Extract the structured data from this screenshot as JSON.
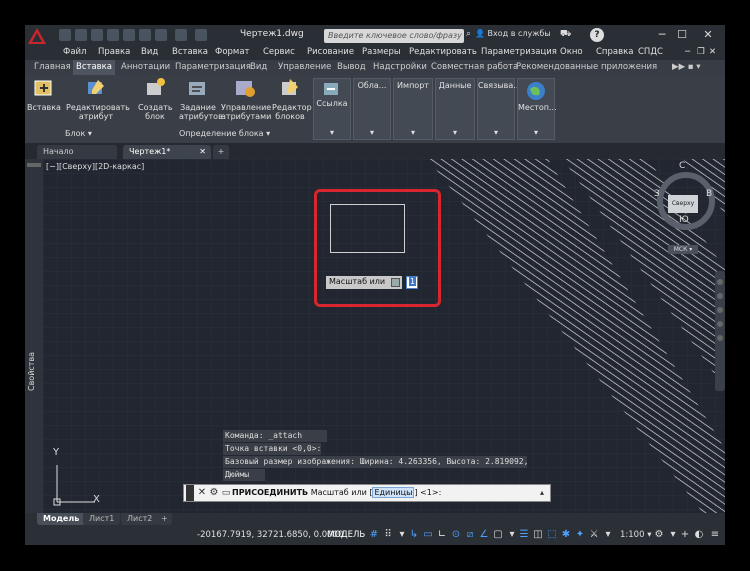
{
  "titlebar": {
    "doc_title": "Чертеж1.dwg",
    "search_placeholder": "Введите ключевое слово/фразу",
    "signin": "Вход в службы",
    "help": "?"
  },
  "menu": [
    "Файл",
    "Правка",
    "Вид",
    "Вставка",
    "Формат",
    "Сервис",
    "Рисование",
    "Размеры",
    "Редактировать",
    "Параметризация",
    "Окно",
    "Справка",
    "СПДС"
  ],
  "ribbon_tabs": [
    "Главная",
    "Вставка",
    "Аннотации",
    "Параметризация",
    "Вид",
    "Управление",
    "Вывод",
    "Надстройки",
    "Совместная работа",
    "Рекомендованные приложения"
  ],
  "ribbon_tabs_more": "▶▶ ▪ ▾",
  "ribbon": {
    "insert": "Вставка",
    "edit_attr": "Редактировать атрибут",
    "create_block": "Создать блок",
    "define_attr": "Задание атрибутов",
    "manage_attr": "Управление атрибутами",
    "block_editor": "Редактор блоков",
    "block_group": "Блок",
    "block_def_group": "Определение блока",
    "reference": "Ссылка",
    "cloud": "Обла...",
    "import": "Импорт",
    "data": "Данные",
    "link": "Связыва...",
    "location": "Местоп..."
  },
  "file_tabs": {
    "start": "Начало",
    "drawing": "Чертеж1*",
    "add": "+"
  },
  "viewport_label": "[−][Сверху][2D-каркас]",
  "side_panel_label": "Свойства",
  "tooltip": {
    "prompt": "Масштаб или",
    "input_value": "1"
  },
  "viewcube": {
    "north": "С",
    "south": "Ю",
    "west": "З",
    "east": "В",
    "face": "Сверху",
    "ucs": "МСК"
  },
  "command_history": [
    "Команда: _attach",
    "Точка вставки <0,0>:",
    "Базовый размер изображения: Ширина: 4.263356, Высота: 2.819092,",
    "Дюймы"
  ],
  "command_line": {
    "command": "ПРИСОЕДИНИТЬ",
    "prompt_before": "Масштаб или [",
    "option": "Единицы",
    "prompt_after": "] <1>:"
  },
  "layout_tabs": [
    "Модель",
    "Лист1",
    "Лист2",
    "+"
  ],
  "status": {
    "coords": "-20167.7919, 32721.6850, 0.0000",
    "model": "МОДЕЛЬ",
    "scale": "1:100"
  },
  "ucs_axes": {
    "y": "Y",
    "x": "X"
  }
}
